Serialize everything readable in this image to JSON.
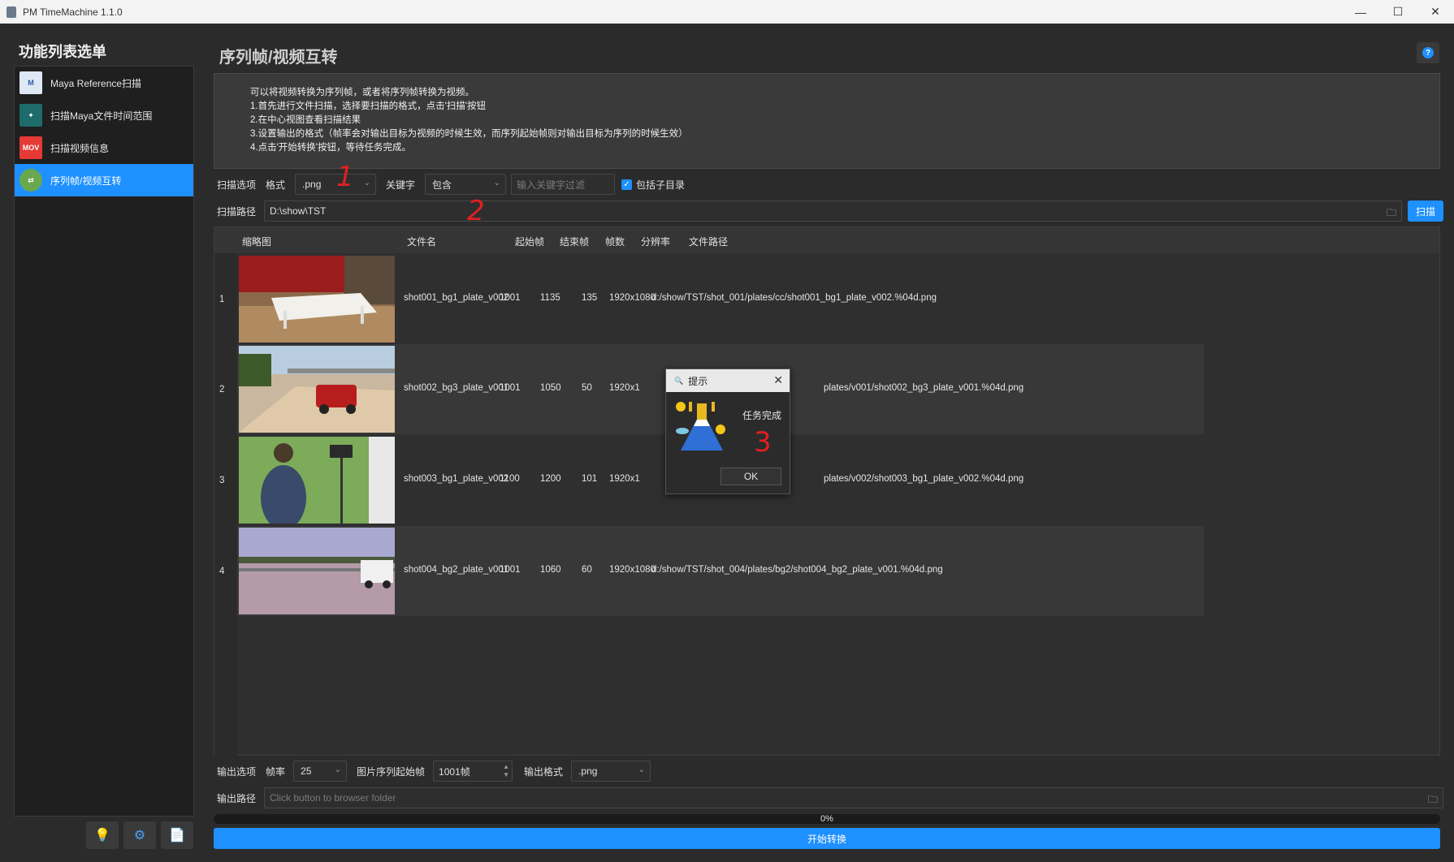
{
  "window": {
    "title": "PM TimeMachine 1.1.0",
    "minimize": "—",
    "maximize": "☐",
    "close": "✕"
  },
  "sidebar": {
    "title": "功能列表选单",
    "items": [
      {
        "label": "Maya Reference扫描",
        "icon": "document-search-icon",
        "glyph": "M"
      },
      {
        "label": "扫描Maya文件时间范围",
        "icon": "film-strip-icon",
        "glyph": "✦"
      },
      {
        "label": "扫描视频信息",
        "icon": "mov-file-icon",
        "glyph": "MOV"
      },
      {
        "label": "序列帧/视频互转",
        "icon": "conversion-icon",
        "glyph": "⇄"
      }
    ],
    "tools": {
      "tips": "💡",
      "settings": "⚙",
      "docs": "📄"
    }
  },
  "main": {
    "title": "序列帧/视频互转",
    "help": "?",
    "description": [
      "可以将视频转换为序列帧，或者将序列帧转换为视频。",
      "1.首先进行文件扫描，选择要扫描的格式，点击'扫描'按钮",
      "2.在中心视图查看扫描结果",
      "3.设置输出的格式（帧率会对输出目标为视频的时候生效，而序列起始帧则对输出目标为序列的时候生效）",
      "4.点击'开始转换'按钮，等待任务完成。"
    ]
  },
  "scan": {
    "options_label": "扫描选项",
    "format_label": "格式",
    "format_value": ".png",
    "keyword_label": "关键字",
    "keyword_mode": "包含",
    "keyword_placeholder": "输入关键字过滤",
    "include_subdirs": "包括子目录",
    "path_label": "扫描路径",
    "path_value": "D:\\show\\TST",
    "scan_button": "扫描"
  },
  "annotations": {
    "a1": "1",
    "a2": "2",
    "a3": "3"
  },
  "table": {
    "headers": [
      "缩略图",
      "文件名",
      "起始帧",
      "结束帧",
      "帧数",
      "分辨率",
      "文件路径"
    ],
    "rows": [
      {
        "num": "1",
        "name": "shot001_bg1_plate_v002",
        "start": "1001",
        "end": "1135",
        "count": "135",
        "res": "1920x1080",
        "path": "d:/show/TST/shot_001/plates/cc/shot001_bg1_plate_v002.%04d.png"
      },
      {
        "num": "2",
        "name": "shot002_bg3_plate_v001",
        "start": "1001",
        "end": "1050",
        "count": "50",
        "res": "1920x1",
        "path": "plates/v001/shot002_bg3_plate_v001.%04d.png"
      },
      {
        "num": "3",
        "name": "shot003_bg1_plate_v002",
        "start": "1100",
        "end": "1200",
        "count": "101",
        "res": "1920x1",
        "path": "plates/v002/shot003_bg1_plate_v002.%04d.png"
      },
      {
        "num": "4",
        "name": "shot004_bg2_plate_v001",
        "start": "1001",
        "end": "1060",
        "count": "60",
        "res": "1920x1080",
        "path": "d:/show/TST/shot_004/plates/bg2/shot004_bg2_plate_v001.%04d.png"
      }
    ]
  },
  "dialog": {
    "title": "提示",
    "message": "任务完成",
    "ok": "OK",
    "close": "✕"
  },
  "output": {
    "options_label": "输出选项",
    "fps_label": "帧率",
    "fps_value": "25",
    "seq_start_label": "图片序列起始帧",
    "seq_start_value": "1001帧",
    "format_label": "输出格式",
    "format_value": ".png",
    "path_label": "输出路径",
    "path_placeholder": "Click button to browser folder",
    "progress": "0%",
    "start_button": "开始转换"
  }
}
